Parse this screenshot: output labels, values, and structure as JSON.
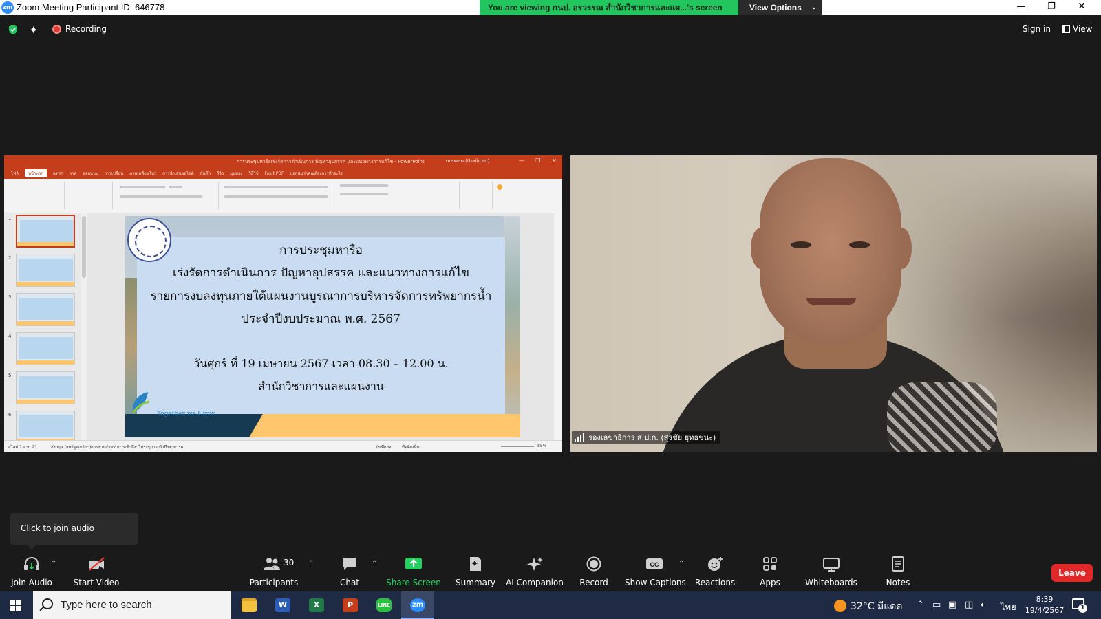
{
  "window": {
    "title": "Zoom Meeting Participant ID: 646778",
    "minimize": "—",
    "restore": "❐",
    "close": "✕"
  },
  "share_banner": {
    "text": "You are viewing กนป. อรวรรณ สำนักวิชาการและแผ...'s screen",
    "view_options": "View Options"
  },
  "meeting_status": {
    "recording": "Recording",
    "sign_in": "Sign in",
    "view": "View"
  },
  "powerpoint": {
    "title": "การประชุมหารือเร่งรัดการดำเนินการ ปัญหาอุปสรรค และแนวทางการแก้ไข - PowerPoint",
    "user": "orawan (thaihcsd)",
    "tabs": [
      "ไฟล์",
      "หน้าแรก",
      "แทรก",
      "วาด",
      "ออกแบบ",
      "การเปลี่ยน",
      "ภาพเคลื่อนไหว",
      "การนำเสนอสไลด์",
      "บันทึก",
      "รีวิว",
      "มุมมอง",
      "วิธีใช้",
      "Foxit PDF",
      "บอกฉันว่าคุณต้องการทำอะไร"
    ],
    "active_tab": "หน้าแรก",
    "thumbnails": [
      "1",
      "2",
      "3",
      "4",
      "5",
      "6"
    ],
    "status_left": "สไลด์ 1 จาก 21",
    "status_lang": "อังกฤษ (สหรัฐอเมริกา)",
    "status_access": "การช่วยสำหรับการเข้าถึง: ไม่ระบุการเข้าถึงสามารถ",
    "status_notes": "บันทึกย่อ",
    "status_comments": "ข้อคิดเห็น",
    "zoom": "85%"
  },
  "slide": {
    "line1": "การประชุมหารือ",
    "line2": "เร่งรัดการดำเนินการ ปัญหาอุปสรรค และแนวทางการแก้ไข",
    "line3": "รายการงบลงทุนภายใต้แผนงานบูรณาการบริหารจัดการทรัพยากรน้ำ",
    "line4": "ประจำปีงบประมาณ พ.ศ. 2567",
    "line5": "วันศุกร์ ที่ 19 เมษายน  2567  เวลา 08.30 – 12.00 น.",
    "line6": "สำนักวิชาการและแผนงาน",
    "tagline": "Together we Grow"
  },
  "participant_video": {
    "name": "รองเลขาธิการ ส.ป.ก. (สุรชัย ยุทธชนะ)"
  },
  "audio_tooltip": "Click to join audio",
  "toolbar": {
    "join_audio": "Join Audio",
    "start_video": "Start Video",
    "participants": "Participants",
    "participants_count": "30",
    "chat": "Chat",
    "share_screen": "Share Screen",
    "summary": "Summary",
    "ai_companion": "AI Companion",
    "record": "Record",
    "show_captions": "Show Captions",
    "reactions": "Reactions",
    "apps": "Apps",
    "whiteboards": "Whiteboards",
    "notes": "Notes",
    "leave": "Leave"
  },
  "taskbar": {
    "search_placeholder": "Type here to search",
    "weather": "32°C มีแดด",
    "language": "ไทย",
    "time": "8:39",
    "date": "19/4/2567",
    "notification_count": "1"
  },
  "colors": {
    "zoom_blue": "#2d8cff",
    "share_green": "#23d160",
    "leave_red": "#e02828",
    "ppt_red": "#c43e1c",
    "taskbar": "#1f2a44"
  }
}
